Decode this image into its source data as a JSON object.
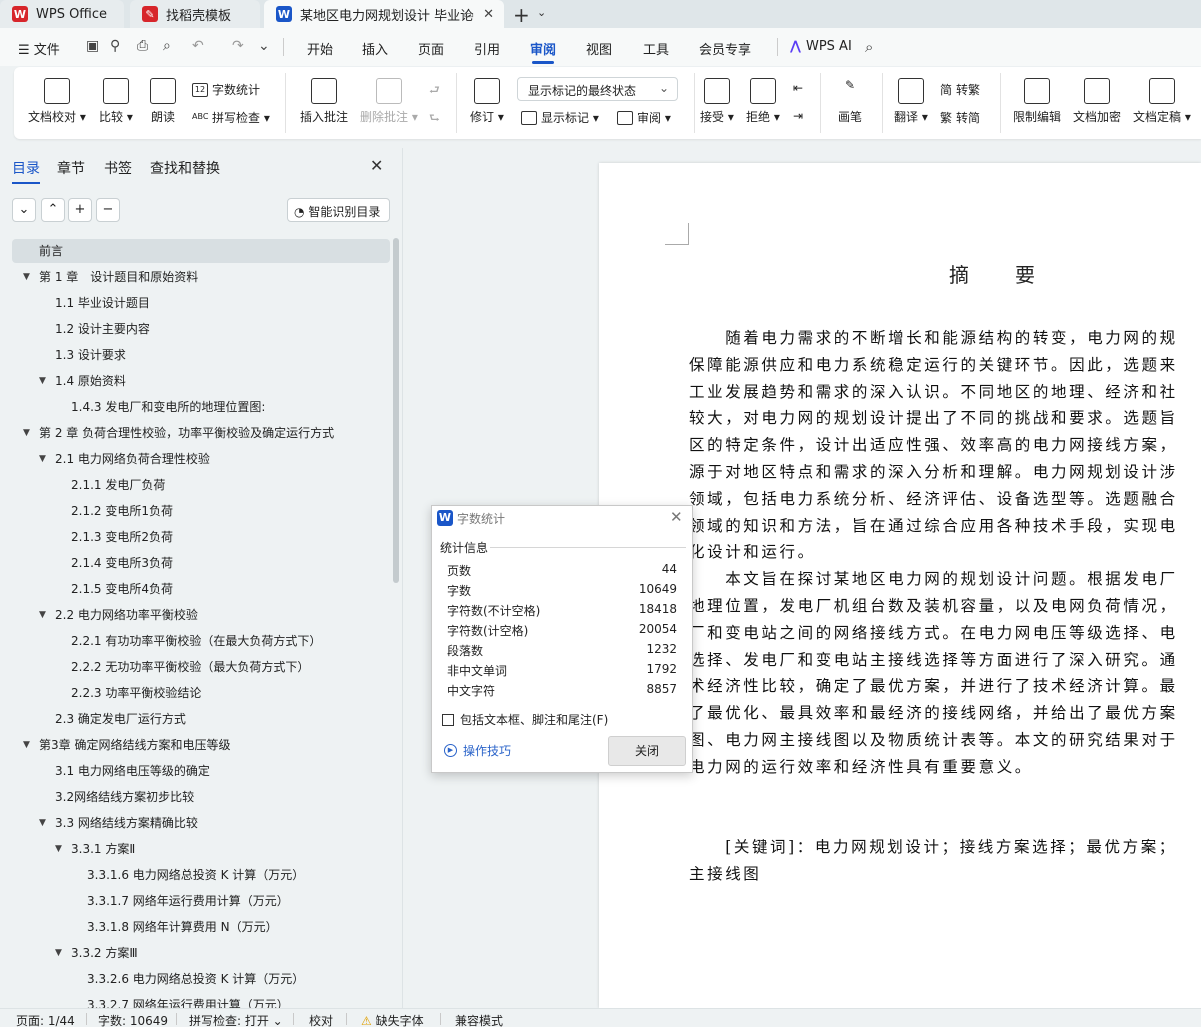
{
  "tabs": [
    {
      "label": "WPS Office",
      "logo": "W",
      "color": "#d7262b"
    },
    {
      "label": "找稻壳模板",
      "logo": "✎",
      "color": "#d7262b"
    },
    {
      "label": "某地区电力网规划设计 毕业论",
      "logo": "W",
      "color": "#1a56c8"
    }
  ],
  "menubar": {
    "file": "文件",
    "tabs": [
      "开始",
      "插入",
      "页面",
      "引用",
      "审阅",
      "视图",
      "工具",
      "会员专享"
    ],
    "active_tab": "审阅",
    "ai": "WPS AI"
  },
  "ribbon": {
    "doc_check": "文档校对",
    "compare": "比较",
    "read_aloud": "朗读",
    "word_count": "字数统计",
    "spell_check": "拼写检查",
    "insert_comment": "插入批注",
    "delete_comment": "删除批注",
    "revise": "修订",
    "markup_select": "显示标记的最终状态",
    "show_markup": "显示标记",
    "review": "审阅",
    "accept": "接受",
    "reject": "拒绝",
    "pen": "画笔",
    "translate": "翻译",
    "to_traditional": "转繁",
    "to_simplified": "转简",
    "restrict_edit": "限制编辑",
    "encrypt": "文档加密",
    "finalize": "文档定稿"
  },
  "nav": {
    "tabs": [
      "目录",
      "章节",
      "书签",
      "查找和替换"
    ],
    "smart_toc": "智能识别目录",
    "toc": [
      {
        "label": "前言",
        "level": 0,
        "tri": false,
        "sel": true
      },
      {
        "label": "第 1 章　设计题目和原始资料",
        "level": 0,
        "tri": true
      },
      {
        "label": "1.1  毕业设计题目",
        "level": 1,
        "tri": false
      },
      {
        "label": "1.2 设计主要内容",
        "level": 1,
        "tri": false
      },
      {
        "label": "1.3 设计要求",
        "level": 1,
        "tri": false
      },
      {
        "label": "1.4  原始资料",
        "level": 1,
        "tri": true
      },
      {
        "label": "1.4.3 发电厂和变电所的地理位置图:",
        "level": 2,
        "tri": false
      },
      {
        "label": "第 2 章 负荷合理性校验，功率平衡校验及确定运行方式",
        "level": 0,
        "tri": true
      },
      {
        "label": "2.1  电力网络负荷合理性校验",
        "level": 1,
        "tri": true
      },
      {
        "label": "2.1.1  发电厂负荷",
        "level": 2,
        "tri": false
      },
      {
        "label": "2.1.2  变电所1负荷",
        "level": 2,
        "tri": false
      },
      {
        "label": "2.1.3  变电所2负荷",
        "level": 2,
        "tri": false
      },
      {
        "label": "2.1.4  变电所3负荷",
        "level": 2,
        "tri": false
      },
      {
        "label": "2.1.5  变电所4负荷",
        "level": 2,
        "tri": false
      },
      {
        "label": "2.2  电力网络功率平衡校验",
        "level": 1,
        "tri": true
      },
      {
        "label": "2.2.1 有功功率平衡校验（在最大负荷方式下）",
        "level": 2,
        "tri": false
      },
      {
        "label": "2.2.2  无功功率平衡校验（最大负荷方式下）",
        "level": 2,
        "tri": false
      },
      {
        "label": "2.2.3  功率平衡校验结论",
        "level": 2,
        "tri": false
      },
      {
        "label": "2.3  确定发电厂运行方式",
        "level": 1,
        "tri": false
      },
      {
        "label": "第3章  确定网络结线方案和电压等级",
        "level": 0,
        "tri": true
      },
      {
        "label": "3.1  电力网络电压等级的确定",
        "level": 1,
        "tri": false
      },
      {
        "label": "3.2网络结线方案初步比较",
        "level": 1,
        "tri": false
      },
      {
        "label": "3.3  网络结线方案精确比较",
        "level": 1,
        "tri": true
      },
      {
        "label": "3.3.1 方案Ⅱ",
        "level": 2,
        "tri": true
      },
      {
        "label": "3.3.1.6 电力网络总投资 K 计算（万元）",
        "level": 3,
        "tri": false
      },
      {
        "label": "3.3.1.7 网络年运行费用计算（万元）",
        "level": 3,
        "tri": false
      },
      {
        "label": "3.3.1.8 网络年计算费用 N（万元）",
        "level": 3,
        "tri": false
      },
      {
        "label": "3.3.2 方案Ⅲ",
        "level": 2,
        "tri": true
      },
      {
        "label": "3.3.2.6 电力网络总投资 K 计算（万元）",
        "level": 3,
        "tri": false
      },
      {
        "label": "3.3.2.7 网络年运行费用计算（万元）",
        "level": 3,
        "tri": false
      }
    ]
  },
  "document": {
    "title": "摘　　要",
    "lines": [
      "　　随着电力需求的不断增长和能源结构的转变，电力网的规",
      "保障能源供应和电力系统稳定运行的关键环节。因此，选题来",
      "工业发展趋势和需求的深入认识。不同地区的地理、经济和社",
      "较大，对电力网的规划设计提出了不同的挑战和要求。选题旨",
      "区的特定条件，设计出适应性强、效率高的电力网接线方案，",
      "源于对地区特点和需求的深入分析和理解。电力网规划设计涉",
      "领域，包括电力系统分析、经济评估、设备选型等。选题融合",
      "领域的知识和方法，旨在通过综合应用各种技术手段，实现电",
      "化设计和运行。",
      "　　本文旨在探讨某地区电力网的规划设计问题。根据发电厂",
      "地理位置，发电厂机组台数及装机容量，以及电网负荷情况，",
      "厂和变电站之间的网络接线方式。在电力网电压等级选择、电",
      "选择、发电厂和变电站主接线选择等方面进行了深入研究。通",
      "术经济性比较，确定了最优方案，并进行了技术经济计算。最",
      "了最优化、最具效率和最经济的接线网络，并给出了最优方案",
      "图、电力网主接线图以及物质统计表等。本文的研究结果对于",
      "电力网的运行效率和经济性具有重要意义。",
      "",
      "",
      "　　[关键词]：电力网规划设计；接线方案选择；最优方案；",
      "主接线图"
    ]
  },
  "dialog": {
    "title": "字数统计",
    "group": "统计信息",
    "stats": [
      {
        "label": "页数",
        "value": "44"
      },
      {
        "label": "字数",
        "value": "10649"
      },
      {
        "label": "字符数(不计空格)",
        "value": "18418"
      },
      {
        "label": "字符数(计空格)",
        "value": "20054"
      },
      {
        "label": "段落数",
        "value": "1232"
      },
      {
        "label": "非中文单词",
        "value": "1792"
      },
      {
        "label": "中文字符",
        "value": "8857"
      }
    ],
    "checkbox": "包括文本框、脚注和尾注(F)",
    "tips": "操作技巧",
    "close": "关闭"
  },
  "statusbar": {
    "page": "页面: 1/44",
    "words": "字数: 10649",
    "spell": "拼写检查: 打开",
    "proof": "校对",
    "missing_font": "缺失字体",
    "compat": "兼容模式"
  }
}
